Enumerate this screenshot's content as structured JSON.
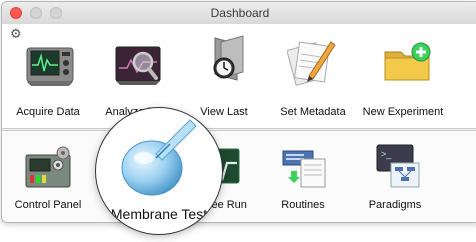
{
  "window": {
    "title": "Dashboard"
  },
  "top_row": [
    {
      "label": "Acquire Data",
      "icon": "oscilloscope-icon"
    },
    {
      "label": "Analyze Data",
      "icon": "analyze-magnifier-icon"
    },
    {
      "label": "View Last",
      "icon": "folder-clock-icon"
    },
    {
      "label": "Set Metadata",
      "icon": "documents-pencil-icon"
    },
    {
      "label": "New Experiment",
      "icon": "folder-add-icon"
    }
  ],
  "bottom_row": [
    {
      "label": "Control Panel",
      "icon": "control-panel-icon"
    },
    {
      "label": "Membrane Test",
      "icon": "pipette-cell-icon"
    },
    {
      "label": "Free Run",
      "icon": "waveform-icon"
    },
    {
      "label": "Routines",
      "icon": "server-document-icon"
    },
    {
      "label": "Paradigms",
      "icon": "terminal-flowchart-icon"
    }
  ],
  "colors": {
    "close": "#fc5753",
    "accent_green": "#3bd15b",
    "folder_yellow": "#f3c94a"
  }
}
